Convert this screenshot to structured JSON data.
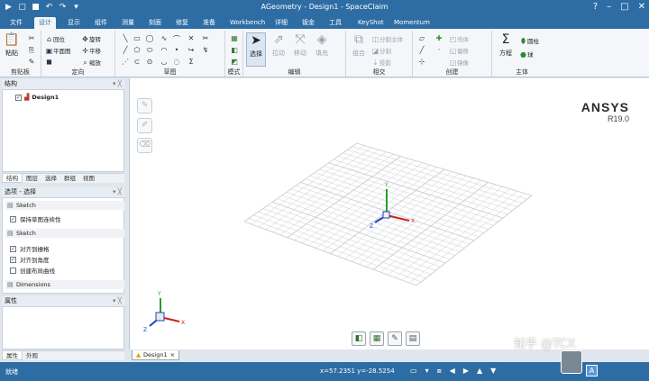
{
  "window": {
    "title": "AGeometry - Design1 - SpaceClaim",
    "controls": [
      "?",
      "–",
      "□",
      "✕"
    ]
  },
  "menu_tabs": [
    "文件",
    "设计",
    "显示",
    "组件",
    "测量",
    "刻面",
    "修复",
    "准备",
    "Workbench",
    "详细",
    "钣金",
    "工具",
    "KeyShot",
    "Momentum"
  ],
  "ribbon": {
    "clipboard": {
      "label": "剪贴板",
      "paste": "粘贴"
    },
    "orient": {
      "label": "定向",
      "home": "回位",
      "plan_view": "平面图",
      "rotate": "旋转",
      "pan": "平移",
      "zoom": "缩放"
    },
    "sketch": {
      "label": "草图"
    },
    "mode": {
      "label": "模式"
    },
    "edit": {
      "label": "编辑",
      "select": "选择",
      "pull": "拉动",
      "move": "移动",
      "fill": "填充"
    },
    "intersect": {
      "label": "相交",
      "combine": "组合",
      "split_body": "分割主体",
      "split": "分割",
      "project": "投影"
    },
    "create": {
      "label": "创建",
      "shell": "壳体",
      "offset": "偏移",
      "mirror": "镜像"
    },
    "body": {
      "label": "主体",
      "equation": "方程",
      "cylinder": "圆柱",
      "sphere": "球"
    }
  },
  "structure_panel": {
    "title": "结构",
    "tree_item": "Design1",
    "tabs": [
      "结构",
      "图层",
      "选择",
      "群组",
      "视图"
    ]
  },
  "options_panel": {
    "title": "选项 - 选择",
    "section1": "Sketch",
    "opt_keep_plane": "保持草图连续性",
    "section2": "Sketch",
    "opt_snap_grid": "对齐到栅格",
    "opt_snap_angle": "对齐到角度",
    "opt_create_layout": "创建布局曲线",
    "section3": "Dimensions"
  },
  "props_panel": {
    "title": "属性",
    "tabs": [
      "属性",
      "外观"
    ]
  },
  "viewport": {
    "brand": "ANSYS",
    "version": "R19.0",
    "axis_labels": [
      "X",
      "Y",
      "Z"
    ]
  },
  "doc_tab": {
    "label": "Design1",
    "close": "×"
  },
  "status": {
    "text": "就绪",
    "coords": "x=57.2351  y=-28.5254"
  },
  "watermark": "知乎 @TCX",
  "lang_indicator": "A",
  "colors": {
    "accent": "#2e6da4",
    "ribbon_bg": "#f4f6f9",
    "grid": "#c8cdd3",
    "x_axis": "#d02020",
    "y_axis": "#2c9a2c",
    "z_axis": "#2040c0"
  }
}
